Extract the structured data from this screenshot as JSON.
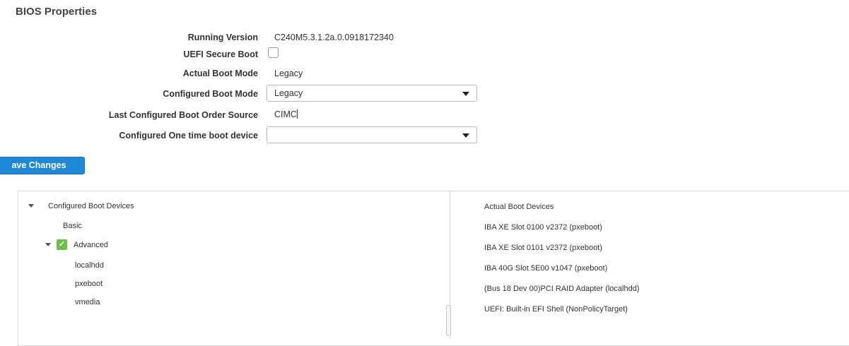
{
  "section_title": "BIOS Properties",
  "properties": {
    "running_version": {
      "label": "Running Version",
      "value": "C240M5.3.1.2a.0.0918172340"
    },
    "uefi_secure_boot": {
      "label": "UEFI Secure Boot",
      "checked": false
    },
    "actual_boot_mode": {
      "label": "Actual Boot Mode",
      "value": "Legacy"
    },
    "configured_boot_mode": {
      "label": "Configured Boot Mode",
      "value": "Legacy"
    },
    "last_boot_order_source": {
      "label": "Last Configured Boot Order Source",
      "value": "CIMC"
    },
    "one_time_boot_device": {
      "label": "Configured One time boot device",
      "value": ""
    }
  },
  "save_button_label": "ave Changes",
  "configured_tree": {
    "root_label": "Configured Boot Devices",
    "basic_label": "Basic",
    "advanced_label": "Advanced",
    "advanced_checked": true,
    "advanced_items": [
      "localhdd",
      "pxeboot",
      "vmedia"
    ]
  },
  "actual_boot": {
    "header": "Actual Boot Devices",
    "items": [
      "IBA XE Slot 0100 v2372 (pxeboot)",
      "IBA XE Slot 0101 v2372 (pxeboot)",
      "IBA 40G Slot 5E00 v1047 (pxeboot)",
      "(Bus 18 Dev 00)PCI RAID Adapter (localhdd)",
      "UEFI: Built-in EFI Shell (NonPolicyTarget)"
    ]
  },
  "colors": {
    "save_button": "#1e88d6",
    "advanced_check": "#6cc04a"
  },
  "icons": [
    "chevron-down-icon",
    "checkmark-icon",
    "triangle-down-icon"
  ]
}
